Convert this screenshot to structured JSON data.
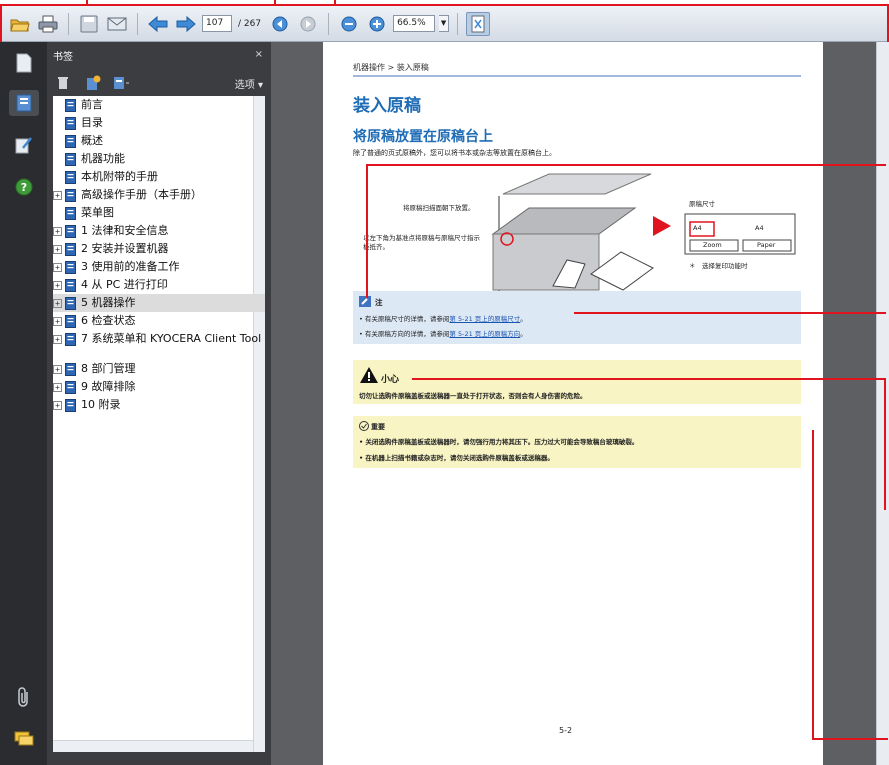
{
  "toolbar": {
    "page_current": "107",
    "page_total": "/ 267",
    "zoom": "66.5%"
  },
  "icons": {
    "open": "open-folder-icon",
    "print": "printer-icon",
    "save": "save-icon",
    "email": "email-icon",
    "prev_page": "arrow-left-icon",
    "next_page": "arrow-right-icon",
    "prev_view": "circle-left-icon",
    "next_view": "circle-right-icon",
    "zoom_out": "zoom-out-icon",
    "zoom_in": "zoom-in-icon",
    "fit": "fit-page-icon",
    "pages": "pages-panel-icon",
    "bookmarks": "bookmarks-panel-icon",
    "signatures": "sign-icon",
    "help": "help-icon",
    "attachments": "paperclip-icon",
    "comments": "comment-icon"
  },
  "bookmarks": {
    "title": "书签",
    "close": "×",
    "options": "选项 ▾",
    "items": [
      {
        "label": "前言",
        "expandable": false
      },
      {
        "label": "目录",
        "expandable": false
      },
      {
        "label": "概述",
        "expandable": false
      },
      {
        "label": "机器功能",
        "expandable": false
      },
      {
        "label": "本机附带的手册",
        "expandable": false
      },
      {
        "label": "高级操作手册（本手册）",
        "expandable": true
      },
      {
        "label": "菜单图",
        "expandable": false
      },
      {
        "label": "1 法律和安全信息",
        "expandable": true
      },
      {
        "label": "2 安装并设置机器",
        "expandable": true
      },
      {
        "label": "3 使用前的准备工作",
        "expandable": true
      },
      {
        "label": "4 从 PC 进行打印",
        "expandable": true
      },
      {
        "label": "5 机器操作",
        "expandable": true,
        "selected": true
      },
      {
        "label": "6 检查状态",
        "expandable": true
      },
      {
        "label": "7 系统菜单和 KYOCERA Client Tool",
        "expandable": true
      },
      {
        "label": "8 部门管理",
        "expandable": true
      },
      {
        "label": "9 故障排除",
        "expandable": true
      },
      {
        "label": "10 附录",
        "expandable": true
      }
    ]
  },
  "page": {
    "breadcrumb": "机器操作 > 装入原稿",
    "h1": "装入原稿",
    "h2": "将原稿放置在原稿台上",
    "intro": "除了普通的页式原稿外，您可以将书本或杂志等放置在原稿台上。",
    "callout_face_down": "将原稿扫描面朝下放置。",
    "callout_corner": "以左下角为基准点将原稿与原稿尺寸指示板抵齐。",
    "original_size": "原稿尺寸",
    "panel_a4_left": "A4",
    "panel_a4_right": "A4",
    "panel_zoom": "Zoom",
    "panel_paper": "Paper",
    "panel_note": "＊　选择复印功能时",
    "note_title": "注",
    "note_1_prefix": "• 有关原稿尺寸的详情，请参阅",
    "note_1_link": "第 5-21 页上的原稿尺寸",
    "note_1_suffix": "。",
    "note_2_prefix": "• 有关原稿方向的详情，请参阅",
    "note_2_link": "第 5-21 页上的原稿方向",
    "note_2_suffix": "。",
    "caution_title": "小心",
    "caution_text": "切勿让选购件原稿盖板或送稿器一直处于打开状态，否则会有人身伤害的危险。",
    "important_title": "重要",
    "important_1": "• 关闭选购件原稿盖板或送稿器时，请勿强行用力将其压下。压力过大可能会导致稿台玻璃破裂。",
    "important_2": "• 在机器上扫描书籍或杂志时，请勿关闭选购件原稿盖板或送稿器。",
    "page_number": "5-2"
  },
  "colors": {
    "heading_blue": "#1f6db6",
    "annotation_red": "#e0141f",
    "note_bg": "#dde8f5",
    "caution_bg": "#f8f4c4",
    "panel_dark": "#3b3d41"
  }
}
